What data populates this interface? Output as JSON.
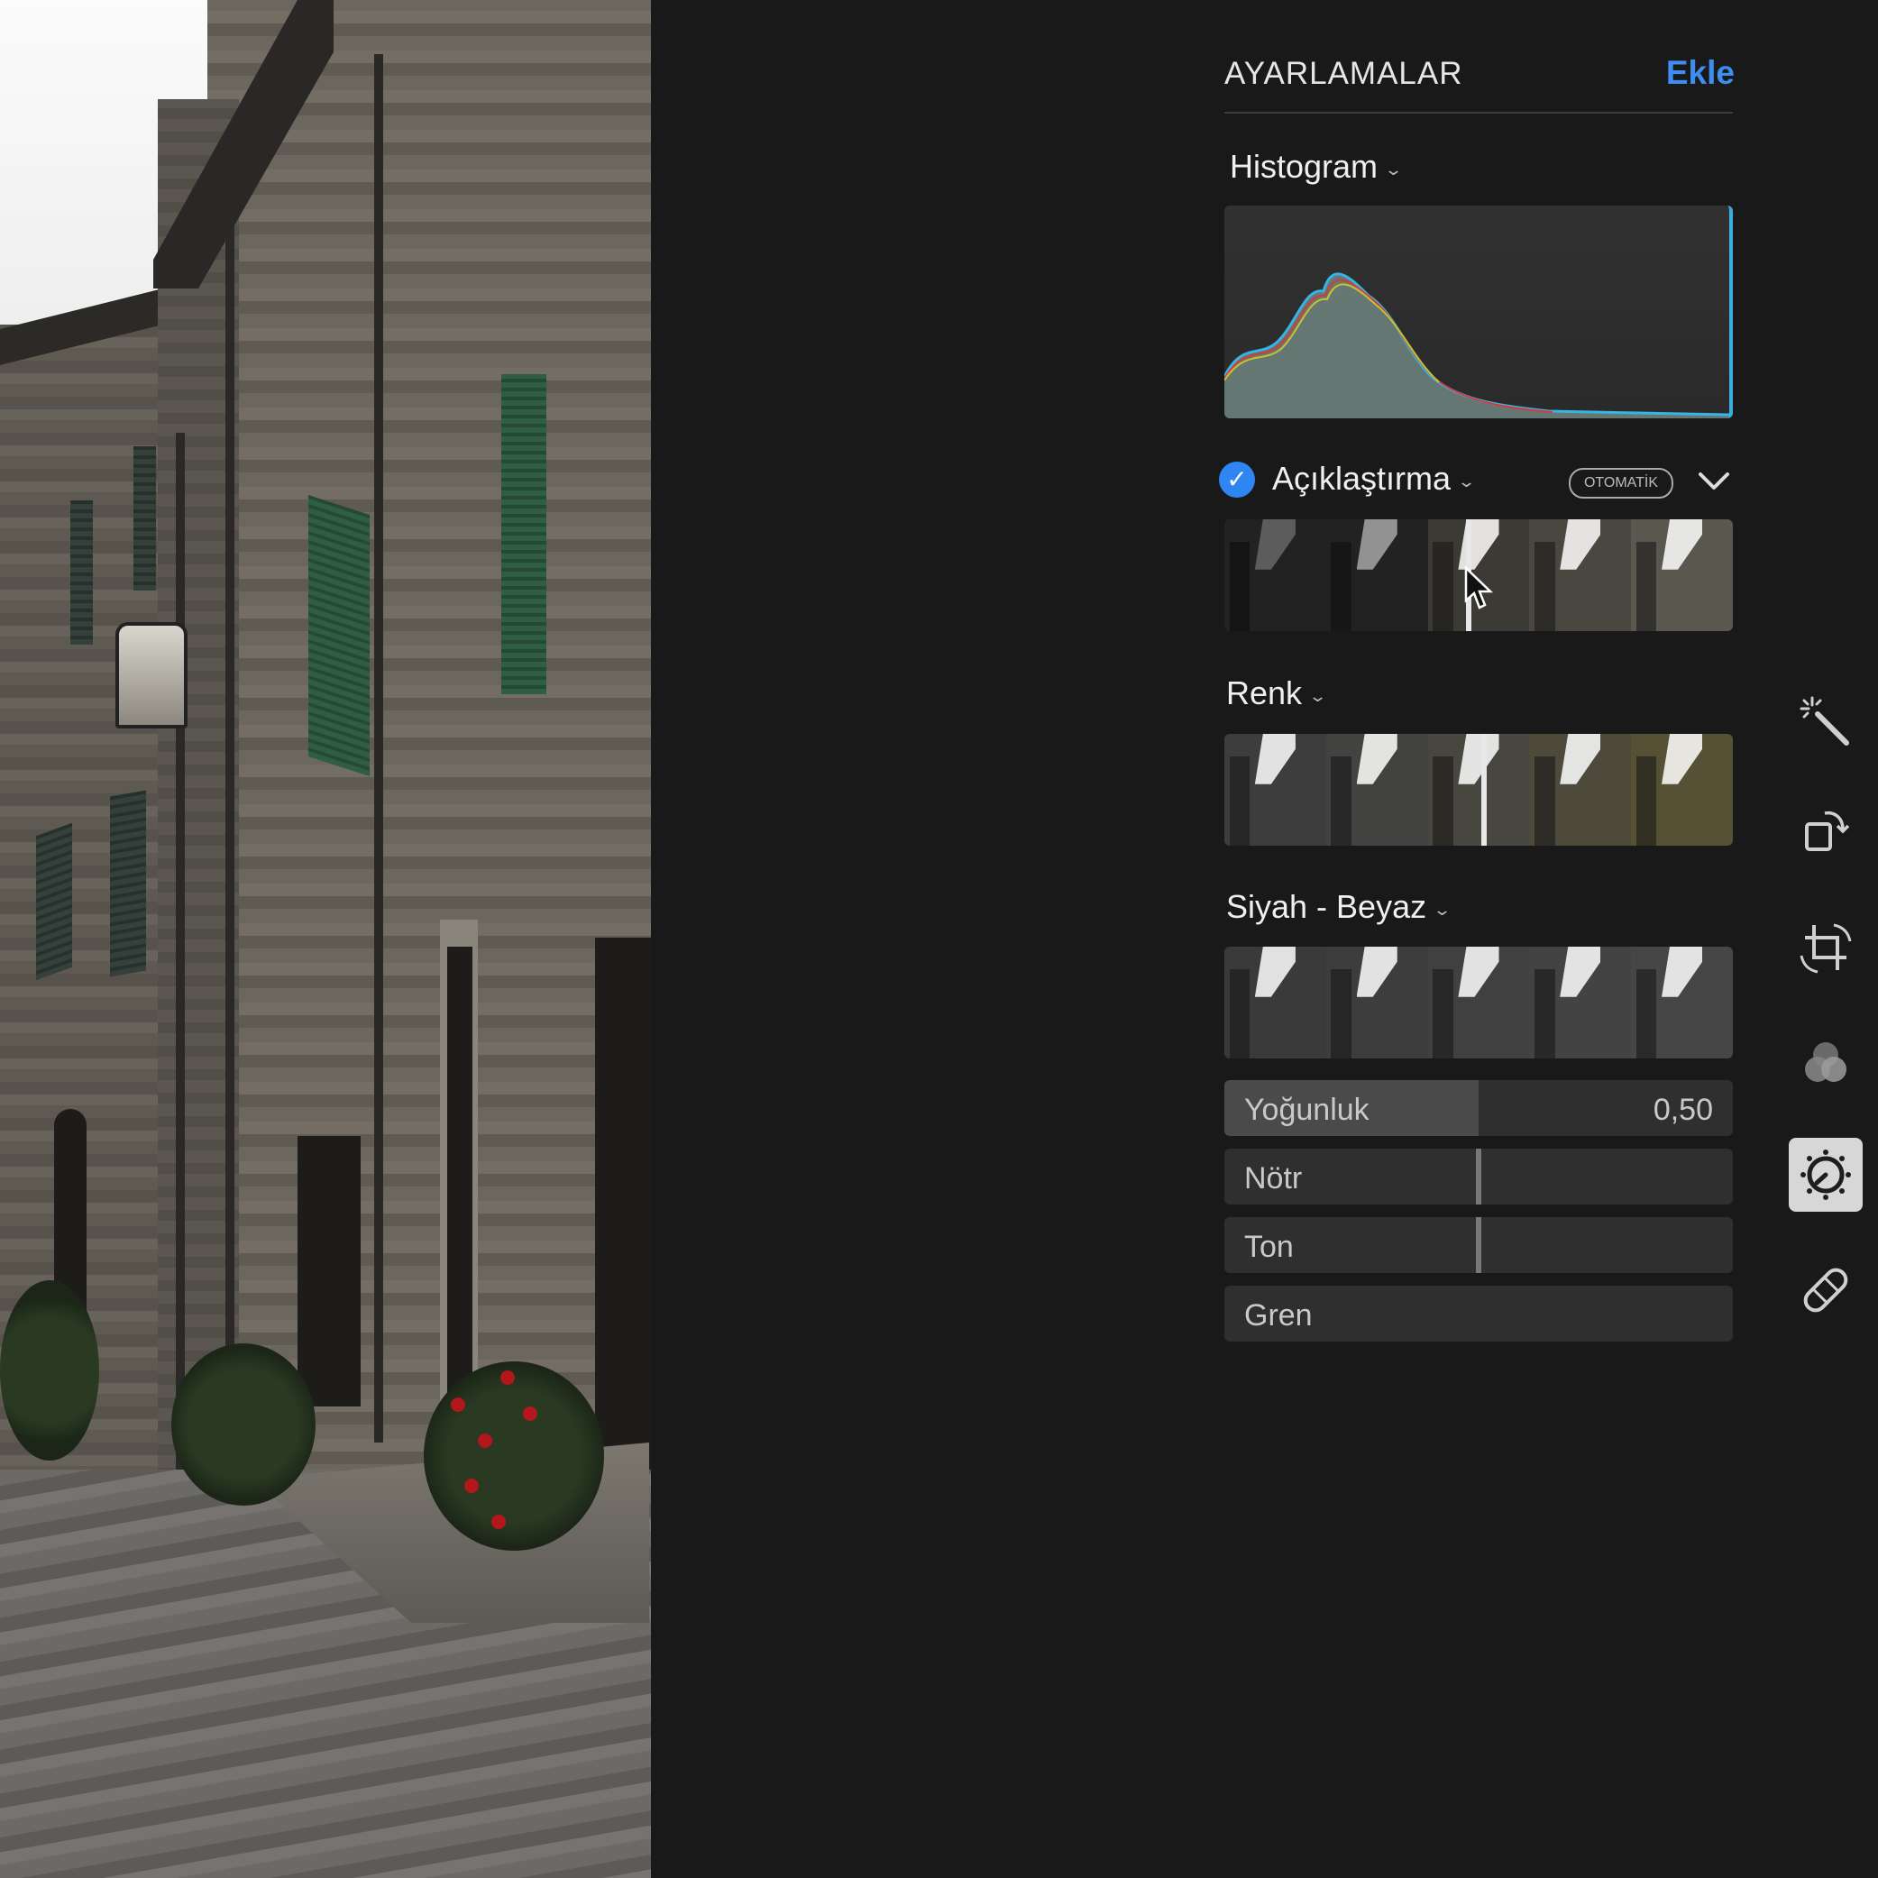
{
  "panel": {
    "title": "AYARLAMALAR",
    "add_label": "Ekle",
    "accent_color": "#3d8ef0"
  },
  "sections": {
    "histogram": {
      "title": "Histogram"
    },
    "light": {
      "title": "Açıklaştırma",
      "enabled": true,
      "badge": "OTOMATİK",
      "marker_position": 0.48
    },
    "color": {
      "title": "Renk",
      "marker_position": 0.51
    },
    "bw": {
      "title": "Siyah - Beyaz"
    }
  },
  "sliders": [
    {
      "label": "Yoğunluk",
      "value": "0,50",
      "level": 0.5
    },
    {
      "label": "Nötr",
      "value": "",
      "level": 0.5
    },
    {
      "label": "Ton",
      "value": "",
      "level": 0.5
    },
    {
      "label": "Gren",
      "value": "",
      "level": 0
    }
  ],
  "tools": [
    {
      "name": "enhance-wand-icon",
      "active": false
    },
    {
      "name": "rotate-icon",
      "active": false
    },
    {
      "name": "crop-icon",
      "active": false
    },
    {
      "name": "filters-icon",
      "active": false
    },
    {
      "name": "adjust-icon",
      "active": true
    },
    {
      "name": "retouch-bandage-icon",
      "active": false
    }
  ]
}
